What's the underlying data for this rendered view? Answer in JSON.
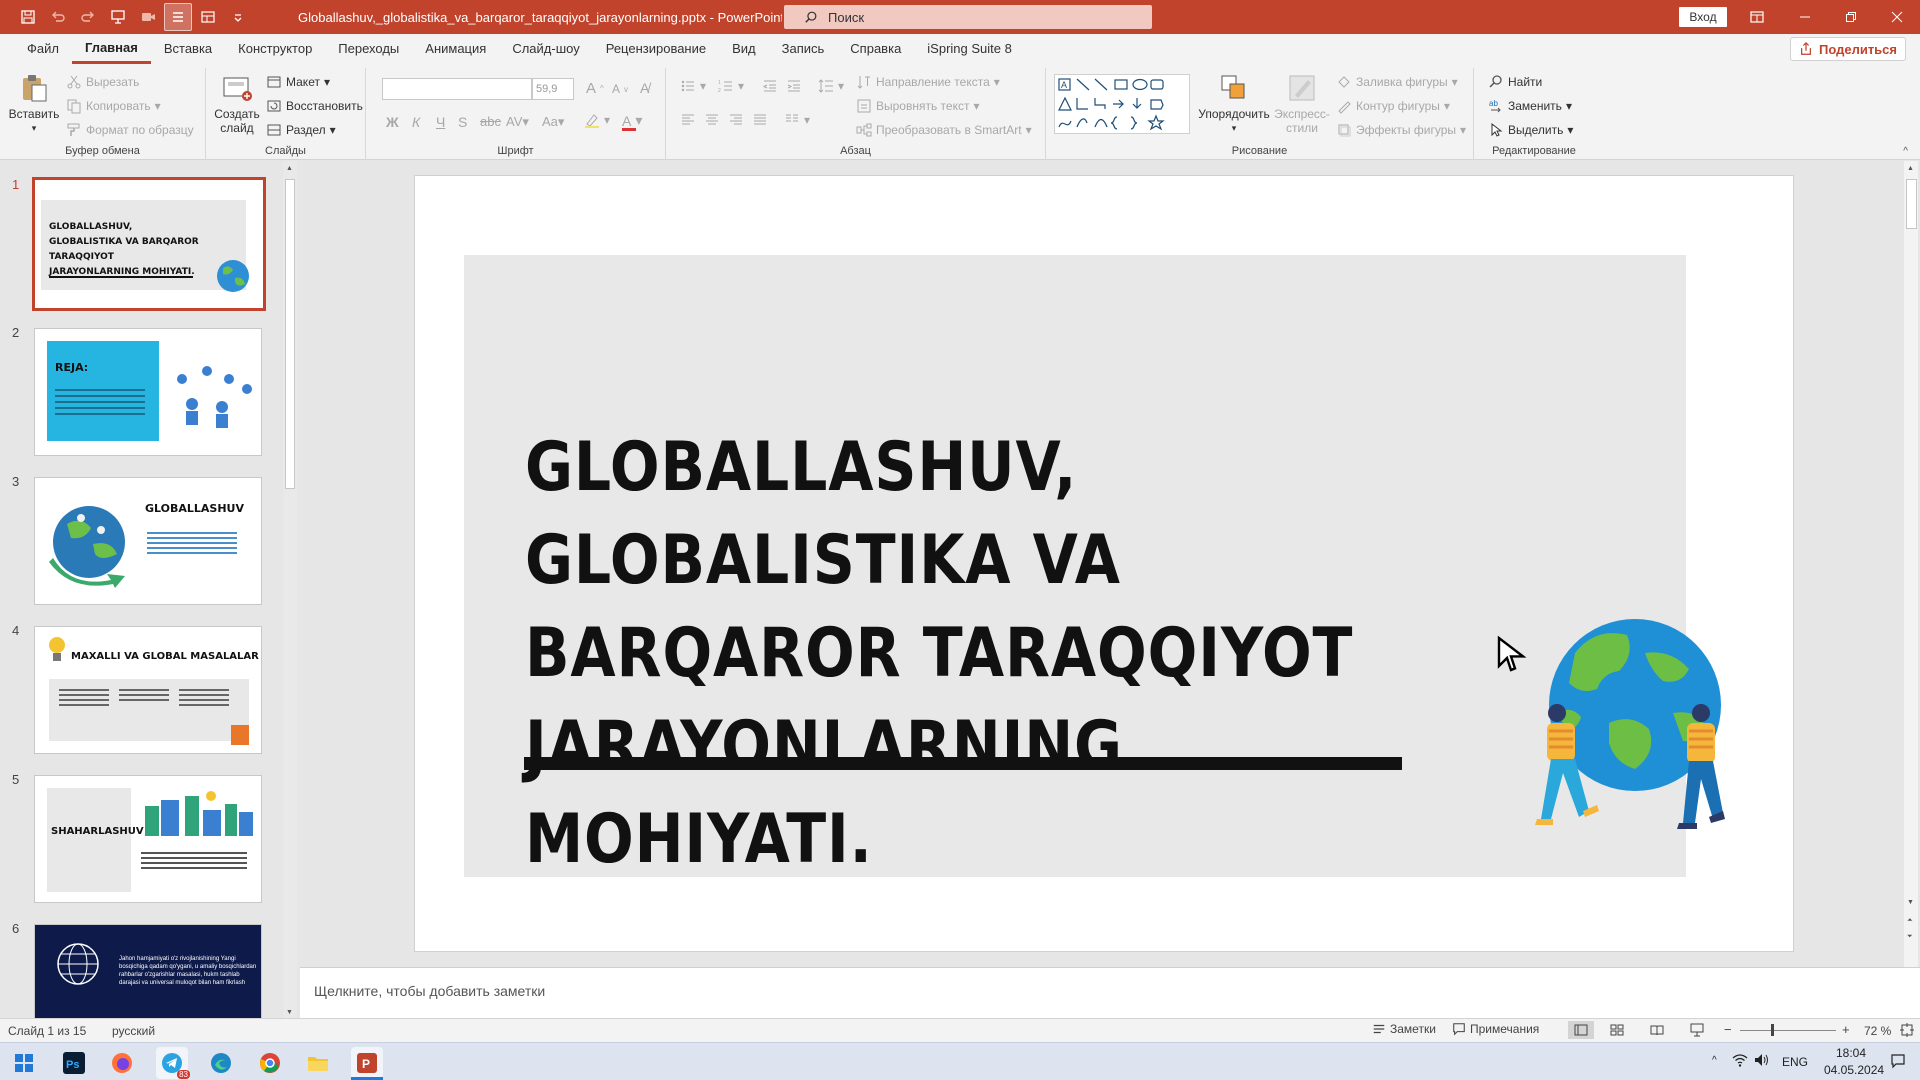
{
  "window": {
    "title": "Globallashuv,_globalistika_va_barqaror_taraqqiyot_jarayonlarning.pptx - PowerPoint",
    "search_placeholder": "Поиск",
    "signin": "Вход",
    "accent": "#c1432c"
  },
  "menu": {
    "items": [
      "Файл",
      "Главная",
      "Вставка",
      "Конструктор",
      "Переходы",
      "Анимация",
      "Слайд-шоу",
      "Рецензирование",
      "Вид",
      "Запись",
      "Справка",
      "iSpring Suite 8"
    ],
    "active": "Главная",
    "share": "Поделиться"
  },
  "ribbon": {
    "clipboard": {
      "label": "Буфер обмена",
      "paste": "Вставить",
      "cut": "Вырезать",
      "copy": "Копировать",
      "format": "Формат по образцу"
    },
    "slides": {
      "label": "Слайды",
      "new_slide_1": "Создать",
      "new_slide_2": "слайд",
      "layout": "Макет",
      "reset": "Восстановить",
      "section": "Раздел"
    },
    "font": {
      "label": "Шрифт",
      "size": "59,9"
    },
    "paragraph": {
      "label": "Абзац",
      "text_direction": "Направление текста",
      "align_text": "Выровнять текст",
      "smartart": "Преобразовать в SmartArt"
    },
    "drawing": {
      "label": "Рисование",
      "arrange": "Упорядочить",
      "quick_styles_1": "Экспресс-",
      "quick_styles_2": "стили",
      "fill": "Заливка фигуры",
      "outline": "Контур фигуры",
      "effects": "Эффекты фигуры"
    },
    "editing": {
      "label": "Редактирование",
      "find": "Найти",
      "replace": "Заменить",
      "select": "Выделить"
    }
  },
  "thumbnails": [
    {
      "num": "1",
      "title": "GLOBALLASHUV, GLOBALISTIKA VA BARQAROR TARAQQIYOT JARAYONLARNING MOHIYATI."
    },
    {
      "num": "2",
      "title": "REJA:"
    },
    {
      "num": "3",
      "title": "GLOBALLASHUV"
    },
    {
      "num": "4",
      "title": "MAXALLI VA GLOBAL MASALALAR"
    },
    {
      "num": "5",
      "title": "SHAHARLASHUV"
    },
    {
      "num": "6",
      "title": "Jahon hamjamiyati o'z rivojlanishining Yangi bosqichiga qadam qo'ygani, u amaliy bosqichlardan rahbarlar o'zgarishlar masalasi, hukm tashlab darajasi va universal muloqot bilan ham fikrlash"
    }
  ],
  "slide": {
    "title": "GLOBALLASHUV, GLOBALISTIKA VA\nBARQAROR TARAQQIYOT\nJARAYONLARNING MOHIYATI."
  },
  "notes_placeholder": "Щелкните, чтобы добавить заметки",
  "status": {
    "slide_counter": "Слайд 1 из 15",
    "language": "русский",
    "notes": "Заметки",
    "comments": "Примечания",
    "zoom": "72 %"
  },
  "taskbar": {
    "telegram_badge": "83",
    "lang": "ENG",
    "time": "18:04",
    "date": "04.05.2024"
  }
}
